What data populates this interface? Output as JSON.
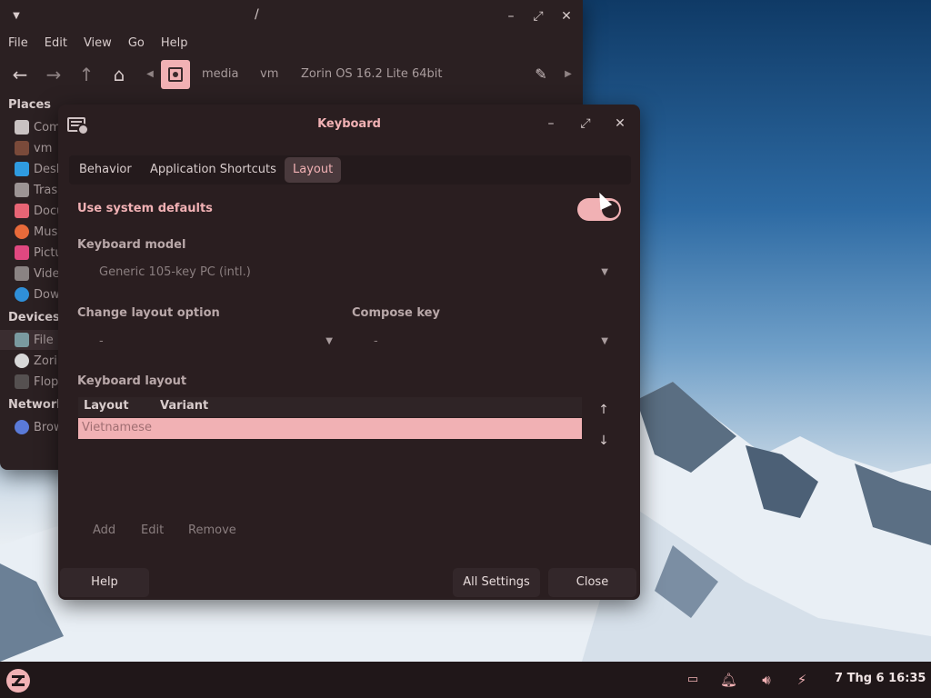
{
  "file_manager": {
    "title": "/",
    "menu": [
      "File",
      "Edit",
      "View",
      "Go",
      "Help"
    ],
    "breadcrumbs": [
      "media",
      "vm",
      "Zorin OS 16.2 Lite 64bit"
    ],
    "sidebar": {
      "places_header": "Places",
      "places": [
        {
          "label": "Com",
          "icon": "computer-icon",
          "color": "#c9c2c2"
        },
        {
          "label": "vm",
          "icon": "home-icon",
          "color": "#7a4a3a"
        },
        {
          "label": "Desk",
          "icon": "desktop-icon",
          "color": "#2f9be0"
        },
        {
          "label": "Tras",
          "icon": "trash-icon",
          "color": "#9c9494"
        },
        {
          "label": "Docu",
          "icon": "documents-icon",
          "color": "#e76575"
        },
        {
          "label": "Musi",
          "icon": "music-icon",
          "color": "#e86a3a"
        },
        {
          "label": "Pictu",
          "icon": "pictures-icon",
          "color": "#e04880"
        },
        {
          "label": "Vide",
          "icon": "videos-icon",
          "color": "#8a8383"
        },
        {
          "label": "Dow",
          "icon": "downloads-icon",
          "color": "#2f8fd8"
        }
      ],
      "devices_header": "Devices",
      "devices": [
        {
          "label": "File",
          "icon": "drive-icon",
          "color": "#7a9aa0"
        },
        {
          "label": "Zorin",
          "icon": "disc-icon",
          "color": "#d8d8d8"
        },
        {
          "label": "Flop",
          "icon": "floppy-icon",
          "color": "#555050"
        }
      ],
      "network_header": "Network",
      "network": [
        {
          "label": "Brow",
          "icon": "network-icon",
          "color": "#5a7ad8"
        }
      ]
    }
  },
  "keyboard_dialog": {
    "title": "Keyboard",
    "tabs": [
      {
        "label": "Behavior",
        "active": false
      },
      {
        "label": "Application Shortcuts",
        "active": false
      },
      {
        "label": "Layout",
        "active": true
      }
    ],
    "use_system_defaults_label": "Use system defaults",
    "use_system_defaults_on": true,
    "keyboard_model_label": "Keyboard model",
    "keyboard_model_value": "Generic 105-key PC (intl.)",
    "change_layout_option_label": "Change layout option",
    "change_layout_option_value": "-",
    "compose_key_label": "Compose key",
    "compose_key_value": "-",
    "keyboard_layout_label": "Keyboard layout",
    "layout_columns": [
      "Layout",
      "Variant"
    ],
    "layout_rows": [
      {
        "layout": "Vietnamese",
        "variant": ""
      }
    ],
    "add_label": "Add",
    "edit_label": "Edit",
    "remove_label": "Remove",
    "help_label": "Help",
    "all_settings_label": "All Settings",
    "close_label": "Close"
  },
  "taskbar": {
    "clock": "7 Thg 6 16:35"
  },
  "colors": {
    "accent": "#f1b1b4",
    "window_bg": "#2a1e20"
  }
}
